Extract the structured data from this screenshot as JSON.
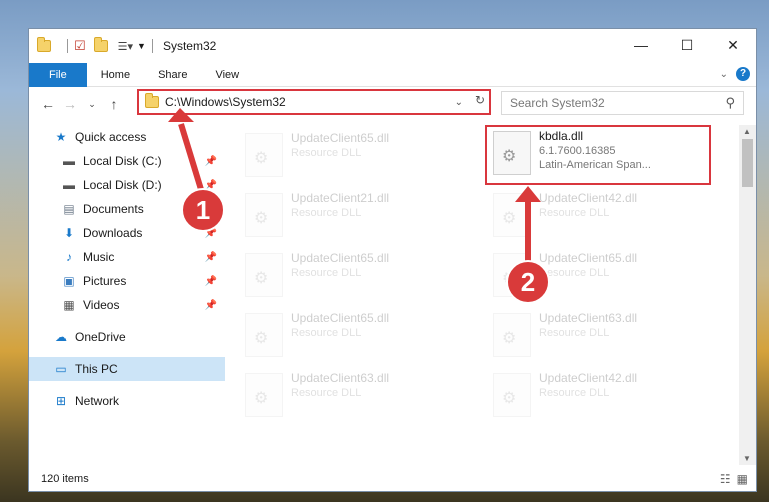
{
  "window": {
    "title": "System32",
    "controls": {
      "minimize": "—",
      "maximize": "☐",
      "close": "✕"
    }
  },
  "ribbon": {
    "tabs": [
      "File",
      "Home",
      "Share",
      "View"
    ],
    "help": "?"
  },
  "address": {
    "path": "C:\\Windows\\System32",
    "search_placeholder": "Search System32"
  },
  "nav": {
    "items": [
      {
        "label": "Quick access",
        "icon": "star-icon"
      },
      {
        "label": "Local Disk (C:)",
        "icon": "drive-icon",
        "pinned": true
      },
      {
        "label": "Local Disk (D:)",
        "icon": "drive-icon",
        "pinned": true
      },
      {
        "label": "Documents",
        "icon": "documents-icon",
        "pinned": true
      },
      {
        "label": "Downloads",
        "icon": "download-icon",
        "pinned": true
      },
      {
        "label": "Music",
        "icon": "music-icon",
        "pinned": true
      },
      {
        "label": "Pictures",
        "icon": "pictures-icon",
        "pinned": true
      },
      {
        "label": "Videos",
        "icon": "videos-icon",
        "pinned": true
      },
      {
        "label": "OneDrive",
        "icon": "cloud-icon"
      },
      {
        "label": "This PC",
        "icon": "computer-icon",
        "selected": true
      },
      {
        "label": "Network",
        "icon": "network-icon"
      }
    ]
  },
  "files": [
    {
      "name": "UpdateClient65.dll",
      "desc": "Resource DLL"
    },
    {
      "name": "kbdla.dll",
      "desc": "6.1.7600.16385",
      "desc2": "Latin-American Span..."
    },
    {
      "name": "UpdateClient21.dll",
      "desc": "Resource DLL"
    },
    {
      "name": "UpdateClient42.dll",
      "desc": "Resource DLL"
    },
    {
      "name": "UpdateClient65.dll",
      "desc": "Resource DLL"
    },
    {
      "name": "UpdateClient65.dll",
      "desc": "Resource DLL"
    },
    {
      "name": "UpdateClient65.dll",
      "desc": "Resource DLL"
    },
    {
      "name": "UpdateClient63.dll",
      "desc": "Resource DLL"
    },
    {
      "name": "UpdateClient63.dll",
      "desc": "Resource DLL"
    },
    {
      "name": "UpdateClient42.dll",
      "desc": "Resource DLL"
    }
  ],
  "status": {
    "items": "120 items"
  },
  "annotations": {
    "marker1": "1",
    "marker2": "2"
  },
  "colors": {
    "accent": "#1979ca",
    "highlight": "#d9363e",
    "selected": "#cce4f7"
  }
}
